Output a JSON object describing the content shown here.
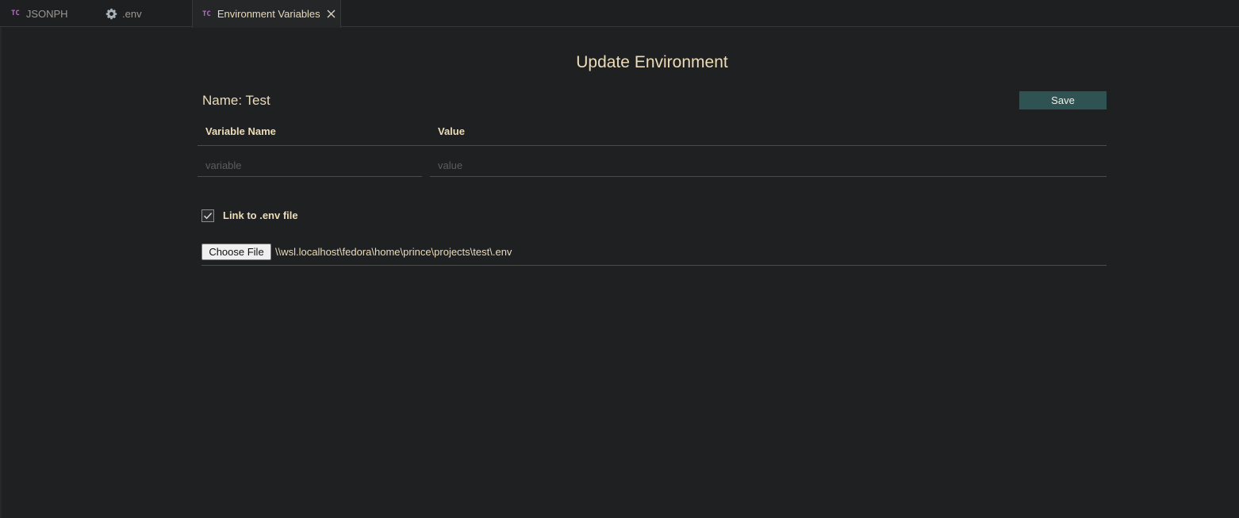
{
  "tabs": [
    {
      "icon": "TC",
      "label": "JSONPH"
    },
    {
      "icon": "gear-icon",
      "label": ".env"
    },
    {
      "icon": "TC",
      "label": "Environment Variables",
      "active": true
    }
  ],
  "page": {
    "title": "Update Environment",
    "name_label": "Name: Test",
    "save_label": "Save"
  },
  "table": {
    "headers": [
      "Variable Name",
      "Value"
    ],
    "new_row": {
      "variable_placeholder": "variable",
      "value_placeholder": "value",
      "variable_value": "",
      "value_value": ""
    }
  },
  "link_env": {
    "checked": true,
    "label": "Link to .env file"
  },
  "file": {
    "button_label": "Choose File",
    "path": "\\\\wsl.localhost\\fedora\\home\\prince\\projects\\test\\.env"
  },
  "colors": {
    "background": "#1e2021",
    "accent_text": "#eddcb8",
    "save_button": "#2f5252",
    "tc_icon": "#b56fc4"
  }
}
